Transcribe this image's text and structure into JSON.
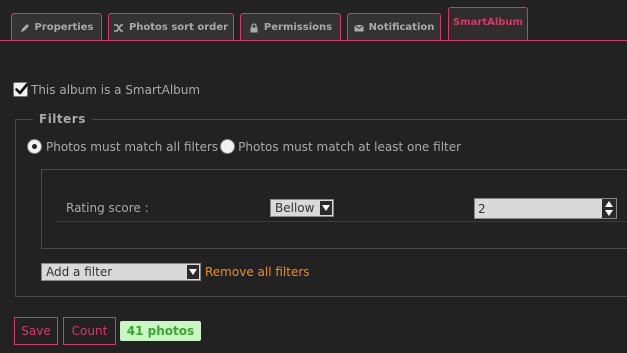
{
  "tabs": [
    {
      "label": "Properties",
      "icon": "pencil-icon",
      "active": false
    },
    {
      "label": "Photos sort order",
      "icon": "shuffle-icon",
      "active": false
    },
    {
      "label": "Permissions",
      "icon": "lock-icon",
      "active": false
    },
    {
      "label": "Notification",
      "icon": "envelope-icon",
      "active": false
    },
    {
      "label": "SmartAlbum",
      "icon": "",
      "active": true
    }
  ],
  "smart_album": {
    "checkbox_label": "This album is a SmartAlbum",
    "checked": true
  },
  "filters": {
    "legend": "Filters",
    "mode_all_label": "Photos must match all filters",
    "mode_any_label": "Photos must match at least one filter",
    "selected_mode": "all",
    "rows": [
      {
        "label": "Rating score :",
        "operator": "Bellow",
        "value": "2"
      }
    ],
    "add_filter_placeholder": "Add a filter",
    "remove_all_label": "Remove all filters"
  },
  "actions": {
    "save_label": "Save",
    "count_label": "Count",
    "result_badge": "41 photos"
  },
  "colors": {
    "accent": "#d7386a",
    "link": "#f28c22",
    "badge_bg": "#c9f7c3",
    "badge_text": "#3aa52c"
  }
}
